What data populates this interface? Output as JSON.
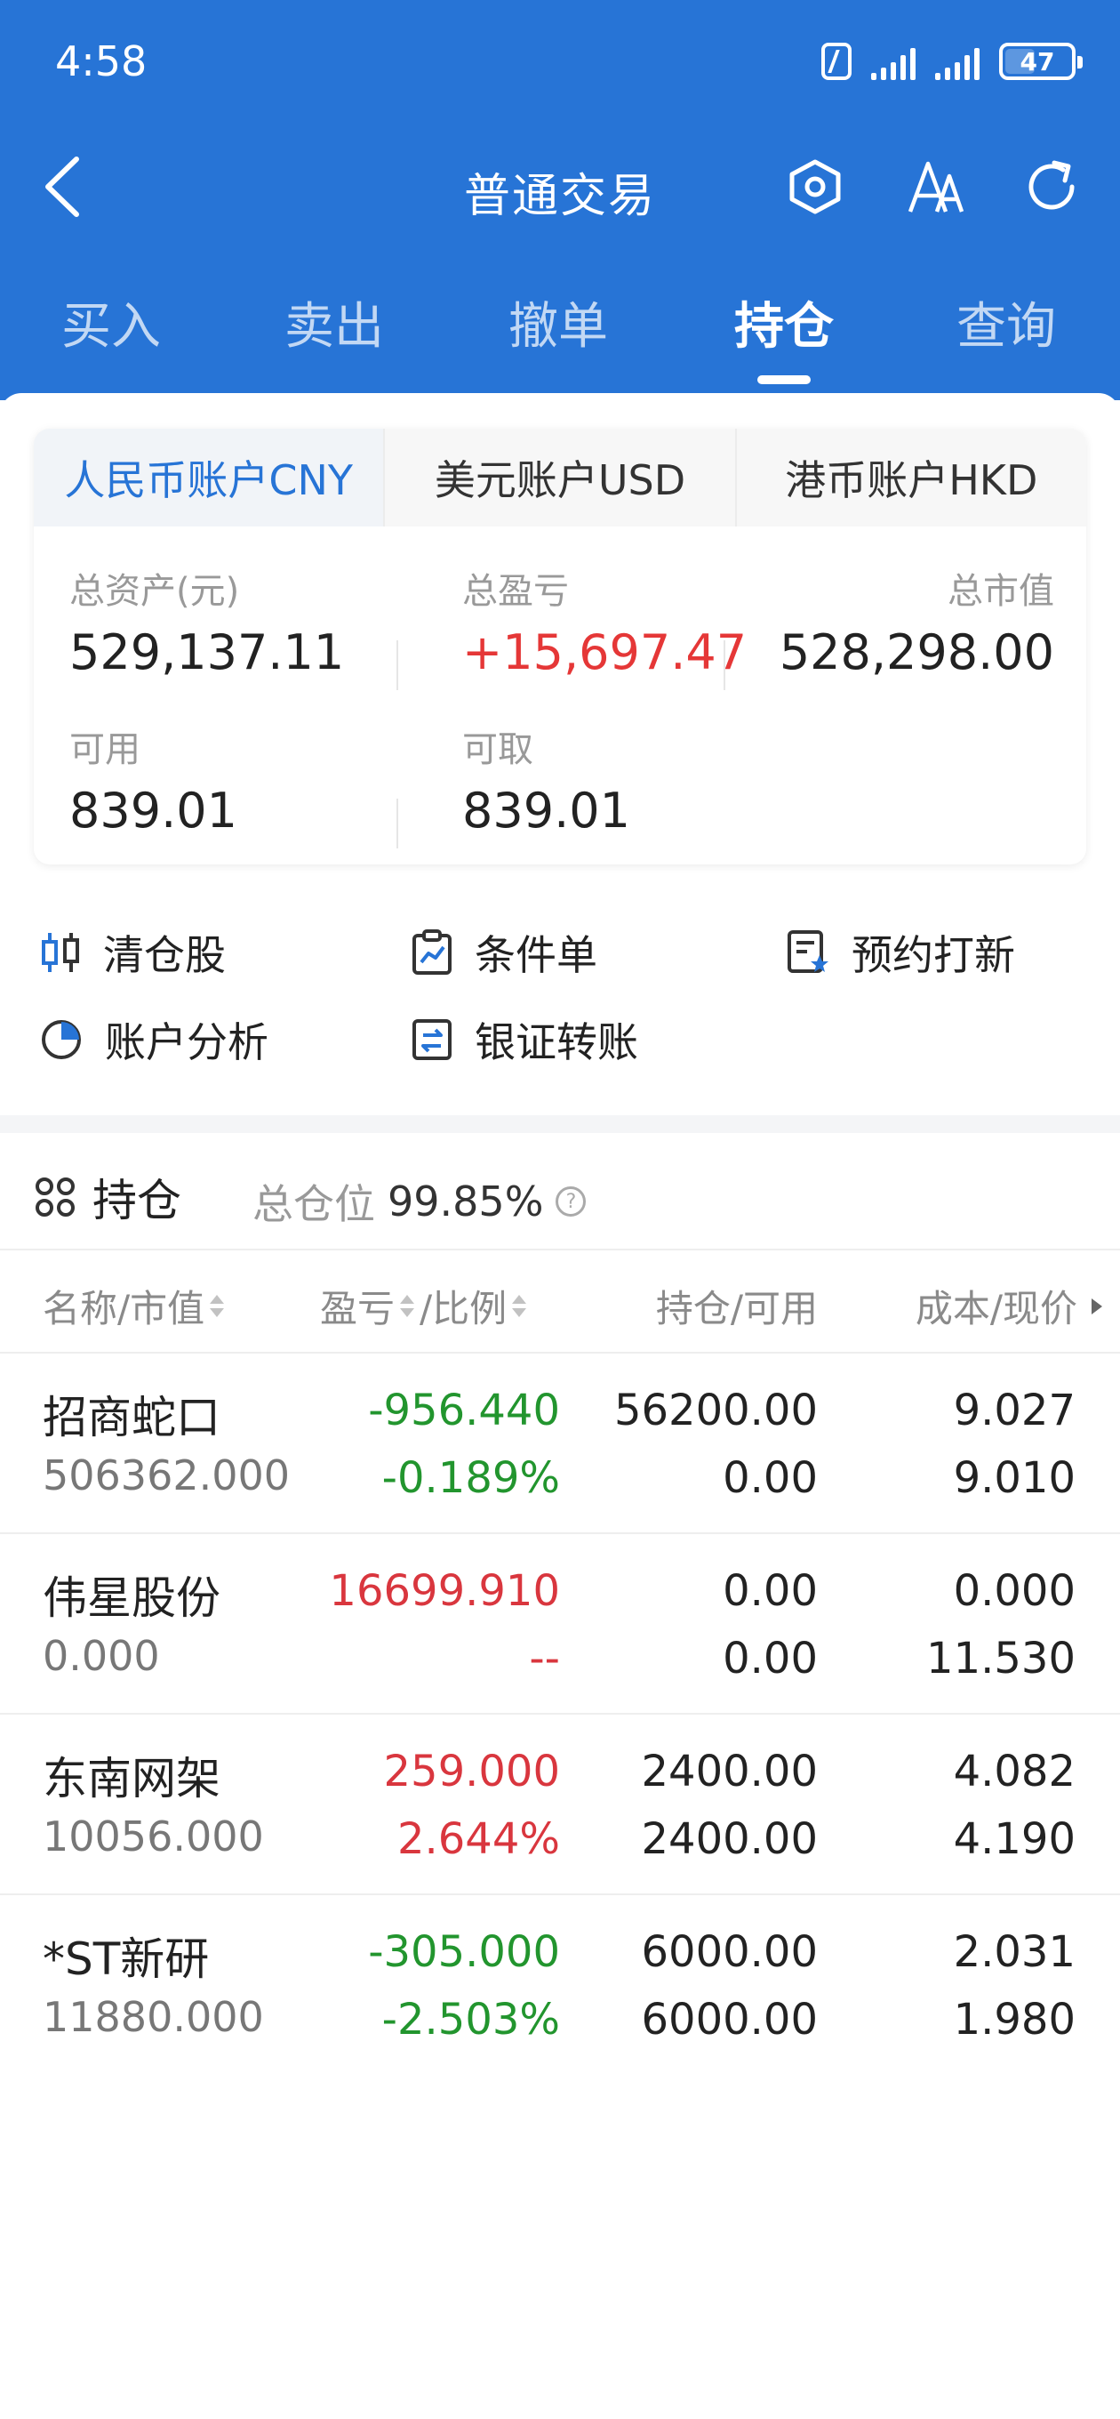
{
  "status_bar": {
    "time": "4:58",
    "battery": "47"
  },
  "nav": {
    "title": "普通交易"
  },
  "tabs": [
    {
      "label": "买入"
    },
    {
      "label": "卖出"
    },
    {
      "label": "撤单"
    },
    {
      "label": "持仓"
    },
    {
      "label": "查询"
    }
  ],
  "active_tab": "持仓",
  "accounts": {
    "tabs": [
      {
        "label": "人民币账户CNY"
      },
      {
        "label": "美元账户USD"
      },
      {
        "label": "港币账户HKD"
      }
    ],
    "active": "人民币账户CNY"
  },
  "metrics": {
    "total_assets_label": "总资产(元)",
    "total_assets": "529,137.11",
    "total_pl_label": "总盈亏",
    "total_pl": "+15,697.47",
    "market_value_label": "总市值",
    "market_value": "528,298.00",
    "available_label": "可用",
    "available": "839.01",
    "withdrawable_label": "可取",
    "withdrawable": "839.01"
  },
  "quick_actions": [
    {
      "label": "清仓股",
      "icon": "candlestick-icon"
    },
    {
      "label": "条件单",
      "icon": "clipboard-chart-icon"
    },
    {
      "label": "预约打新",
      "icon": "document-star-icon"
    },
    {
      "label": "账户分析",
      "icon": "pie-chart-icon"
    },
    {
      "label": "银证转账",
      "icon": "transfer-icon"
    }
  ],
  "holdings": {
    "title": "持仓",
    "ratio_label": "总仓位",
    "ratio_value": "99.85%",
    "help_glyph": "?",
    "columns": [
      "名称/市值",
      "盈亏",
      "/比例",
      "持仓/可用",
      "成本/现价"
    ],
    "rows": [
      {
        "name": "招商蛇口",
        "market_value": "506362.000",
        "pl": "-956.440",
        "pl_ratio": "-0.189%",
        "position": "56200.00",
        "available": "0.00",
        "cost": "9.027",
        "price": "9.010",
        "trend": "down"
      },
      {
        "name": "伟星股份",
        "market_value": "0.000",
        "pl": "16699.910",
        "pl_ratio": "--",
        "position": "0.00",
        "available": "0.00",
        "cost": "0.000",
        "price": "11.530",
        "trend": "up"
      },
      {
        "name": "东南网架",
        "market_value": "10056.000",
        "pl": "259.000",
        "pl_ratio": "2.644%",
        "position": "2400.00",
        "available": "2400.00",
        "cost": "4.082",
        "price": "4.190",
        "trend": "up"
      },
      {
        "name": "*ST新研",
        "market_value": "11880.000",
        "pl": "-305.000",
        "pl_ratio": "-2.503%",
        "position": "6000.00",
        "available": "6000.00",
        "cost": "2.031",
        "price": "1.980",
        "trend": "down"
      }
    ]
  },
  "colors": {
    "primary": "#2774d6",
    "up": "#d9363e",
    "down": "#22952e"
  }
}
